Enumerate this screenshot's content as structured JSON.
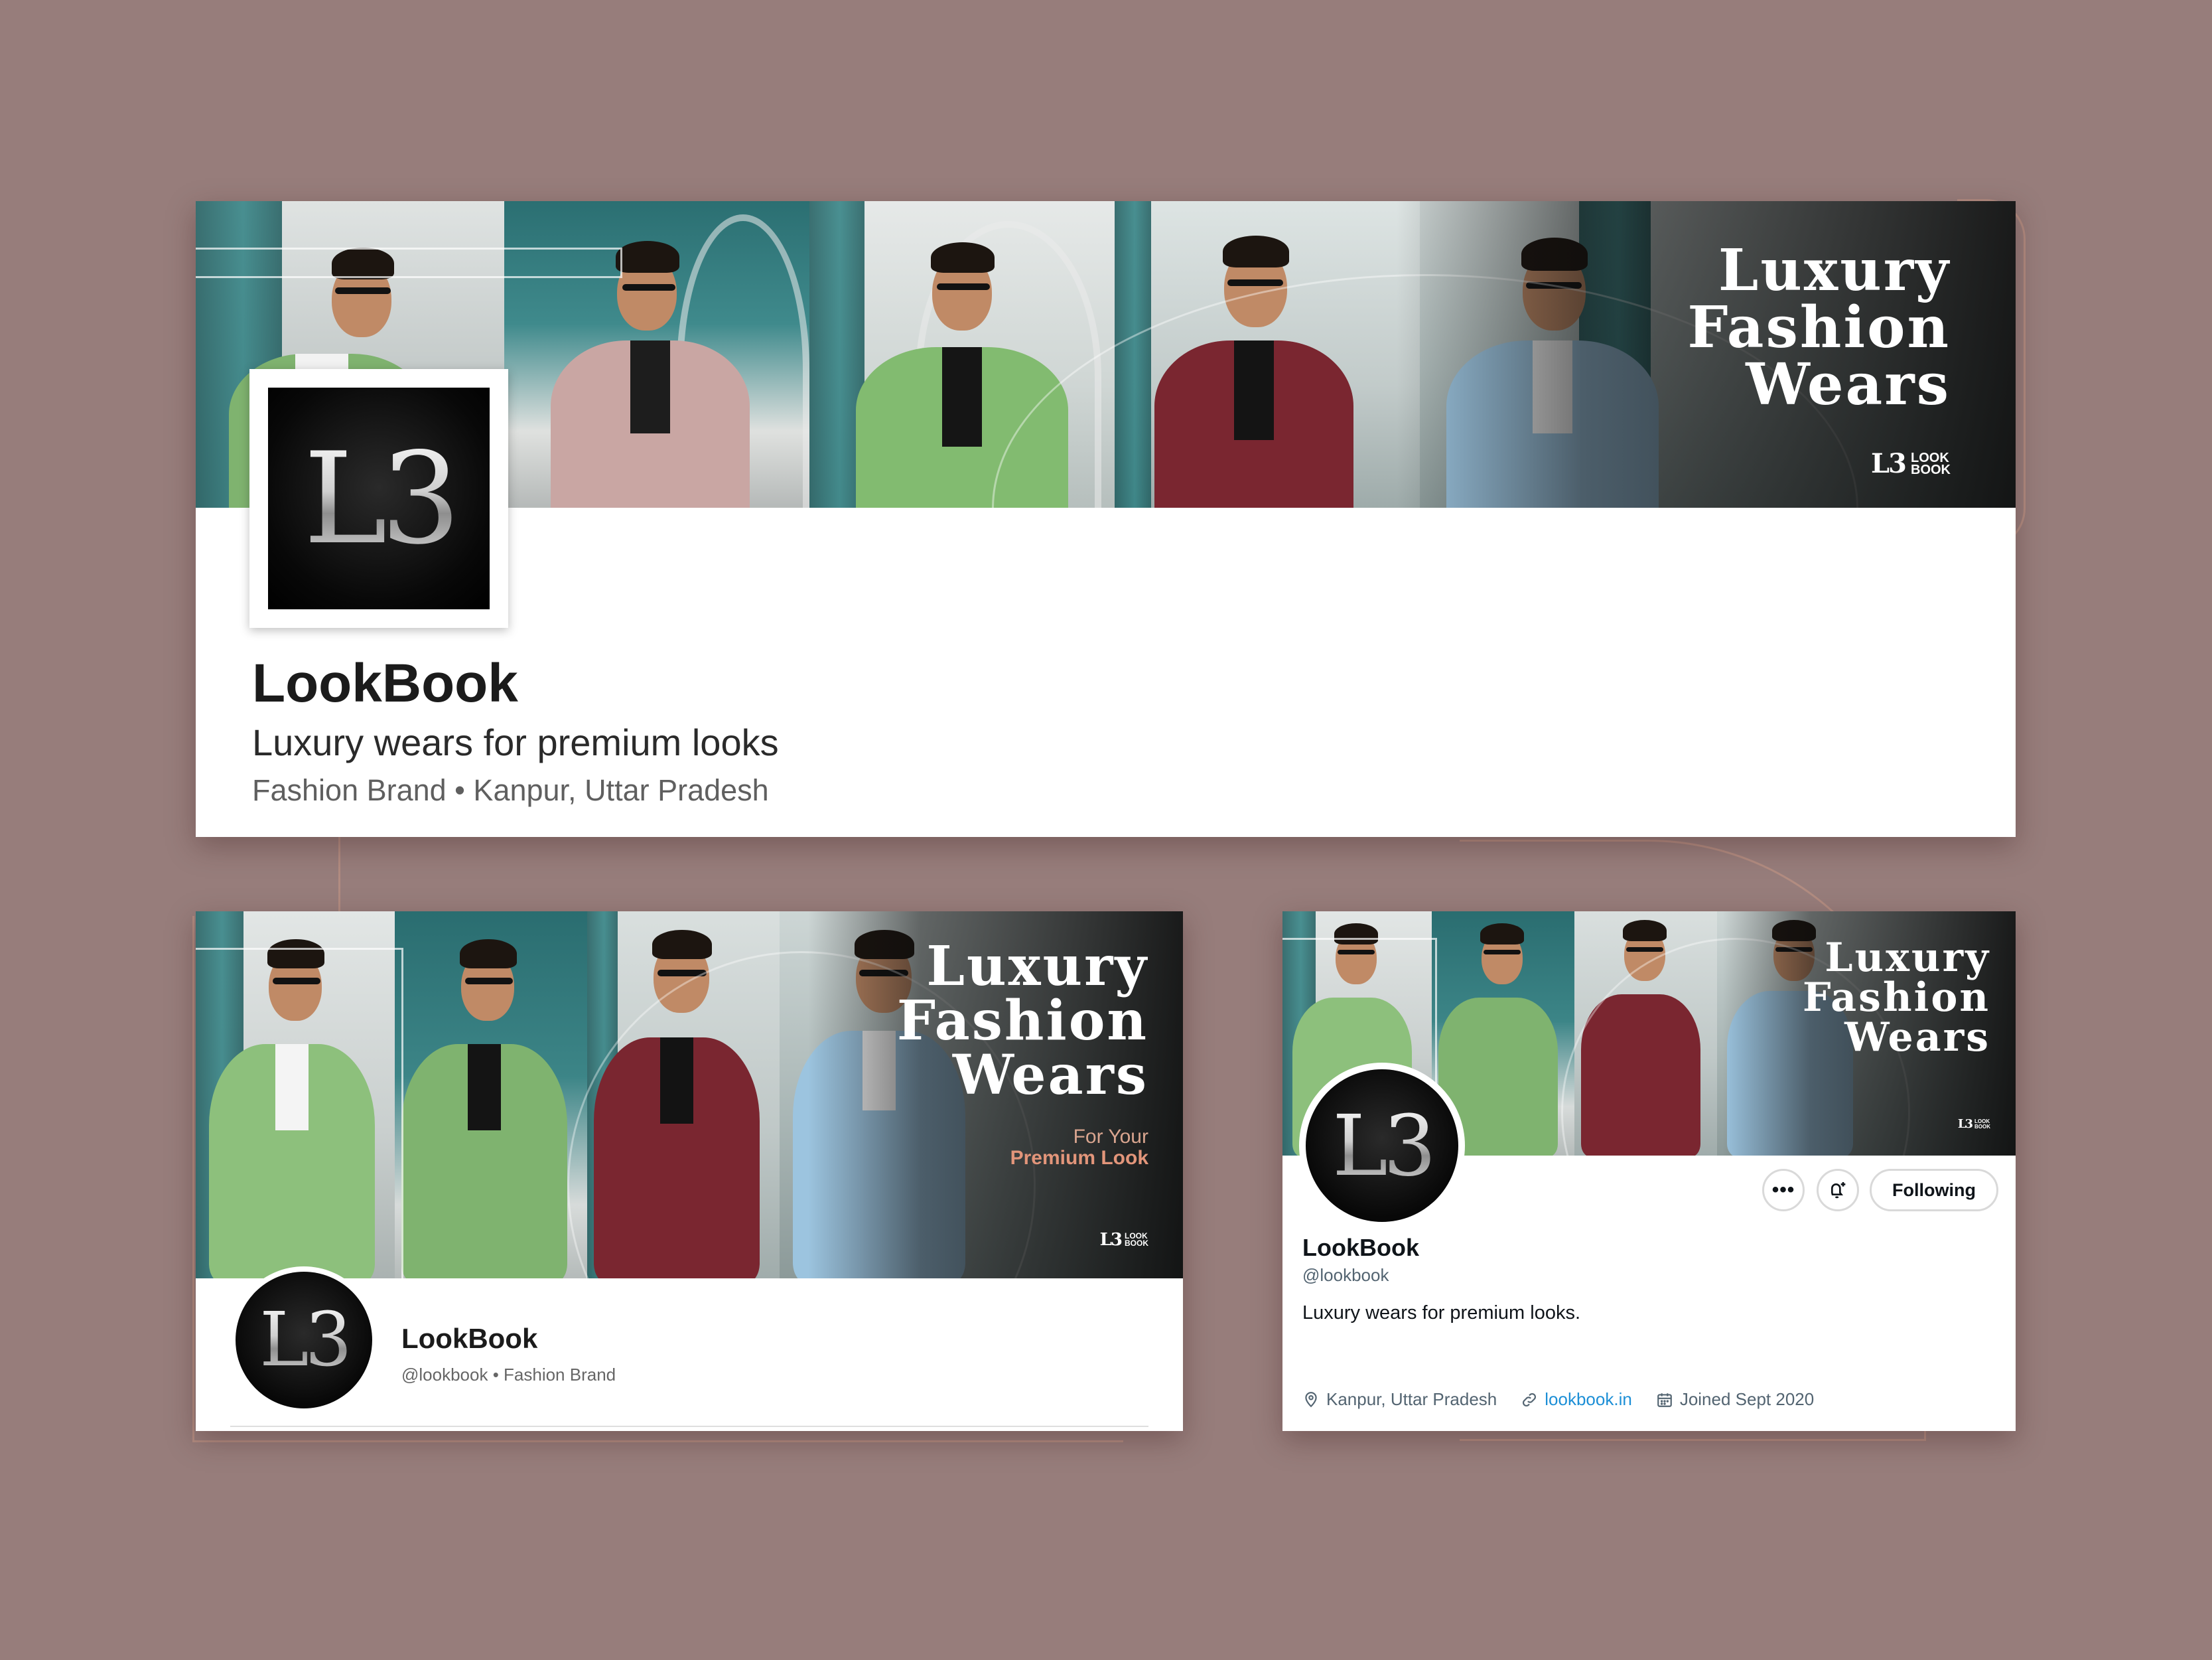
{
  "background_color": "#977d7b",
  "banner": {
    "headline": [
      "Luxury",
      "Fashion",
      "Wears"
    ],
    "tagline_line1": "For Your",
    "tagline_line2": "Premium Look",
    "brand_monogram": "L3",
    "brand_wordmark": [
      "LOOK",
      "BOOK"
    ]
  },
  "logo_monogram": "L3",
  "linkedin": {
    "name": "LookBook",
    "tagline": "Luxury wears for premium looks",
    "meta": "Fashion Brand • Kanpur, Uttar Pradesh"
  },
  "facebook": {
    "name": "LookBook",
    "meta": "@lookbook • Fashion Brand"
  },
  "twitter": {
    "name": "LookBook",
    "handle": "@lookbook",
    "bio": "Luxury wears for premium looks.",
    "more_icon": "ellipsis-icon",
    "notify_icon": "bell-plus-icon",
    "follow_button": "Following",
    "location": "Kanpur, Uttar Pradesh",
    "website": "lookbook.in",
    "joined": "Joined Sept 2020"
  },
  "colors": {
    "accent_peach": "#e2957a",
    "link_blue": "#1d8fd6",
    "suit_green": "#7fb36f",
    "suit_pink": "#c9a6a3",
    "suit_maroon": "#7a2630",
    "suit_blue": "#9cc4df"
  }
}
